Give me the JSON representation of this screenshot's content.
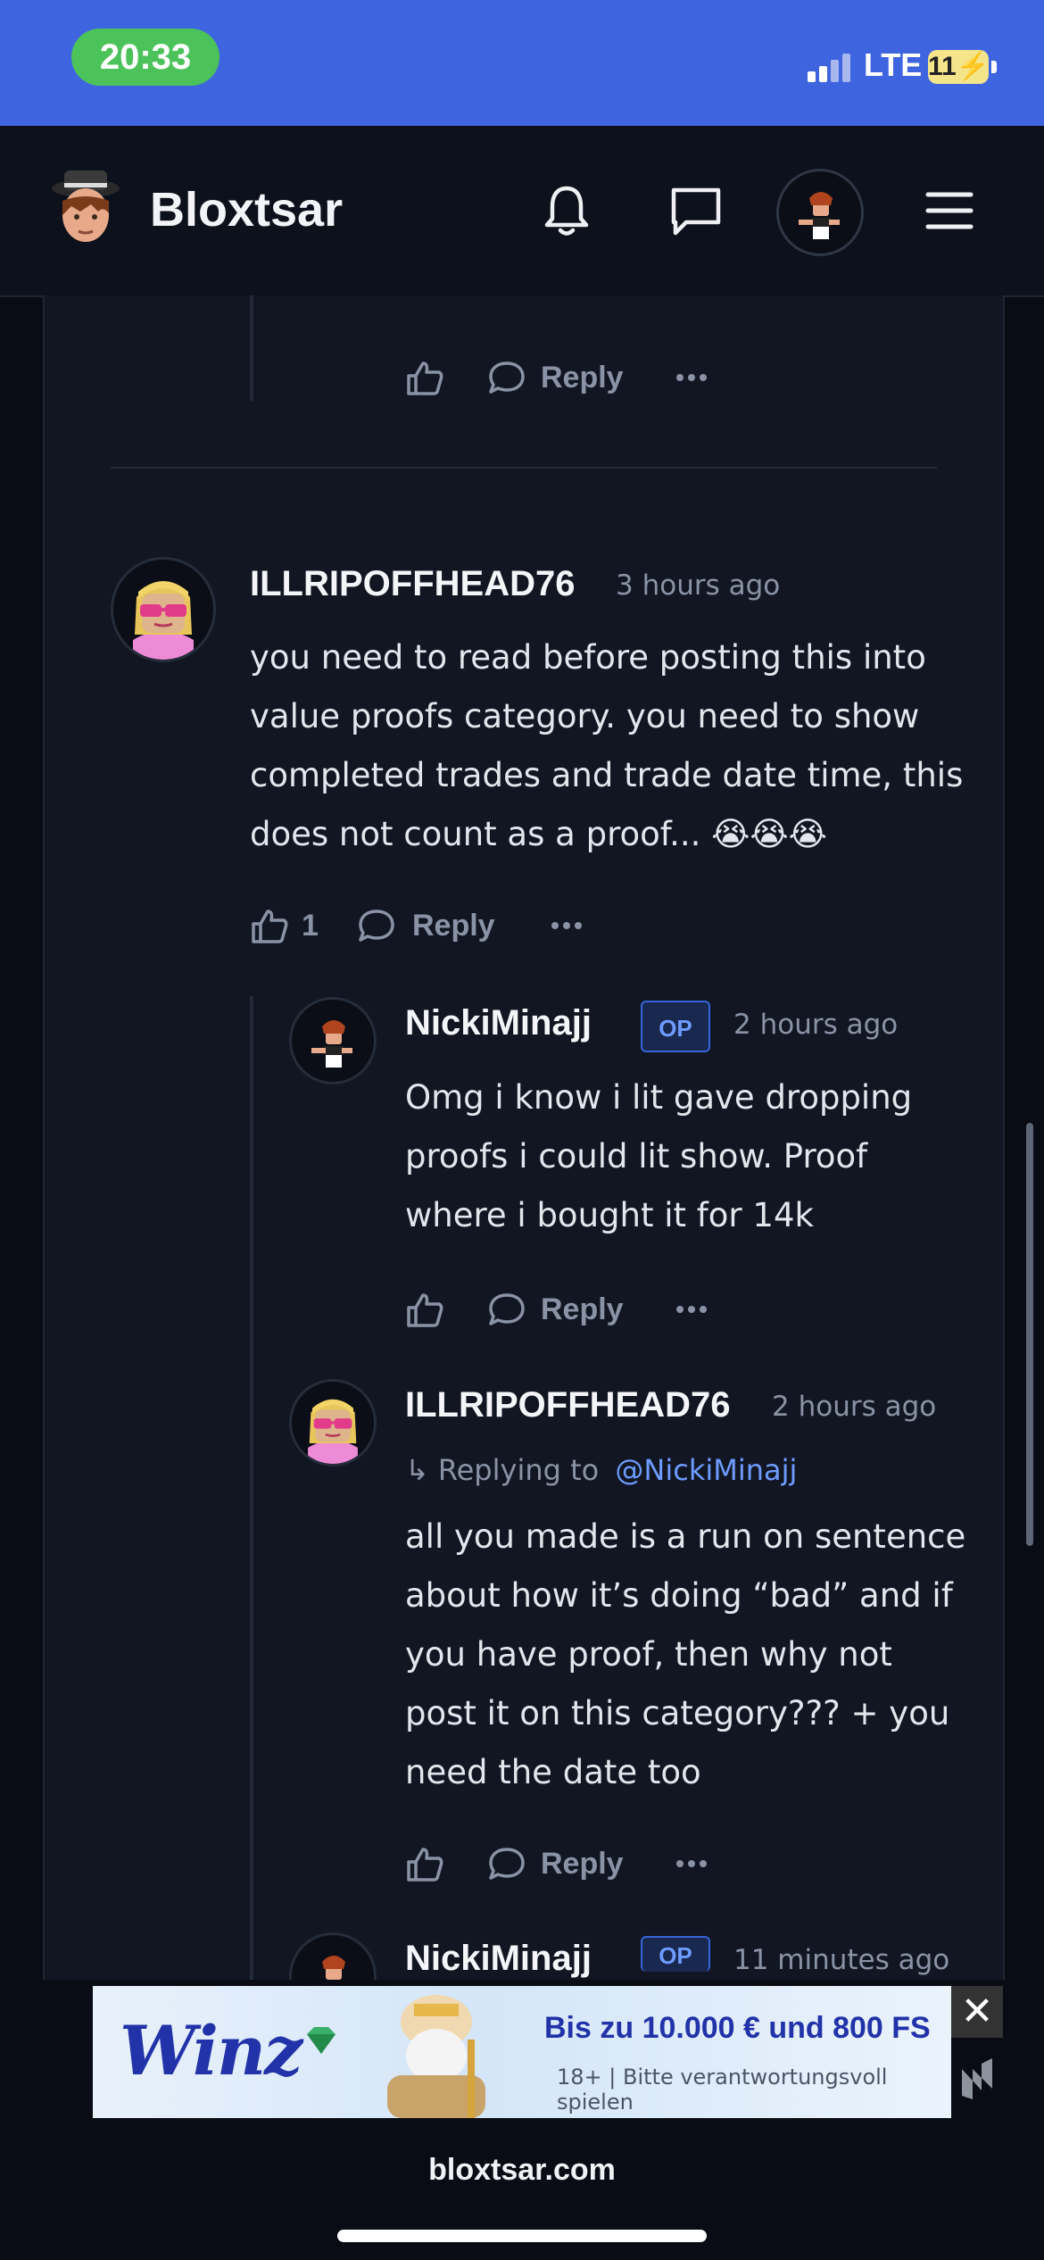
{
  "status_bar": {
    "time": "20:33",
    "network": "LTE",
    "battery": "11"
  },
  "header": {
    "brand": "Bloxtsar"
  },
  "thread": {
    "top_comment_actions": {
      "reply_label": "Reply"
    },
    "comment1": {
      "username": "ILLRIPOFFHEAD76",
      "time": "3 hours ago",
      "lines": [
        "you need to read before posting this into",
        "value proofs category. you need to show",
        "completed trades and trade date time, this",
        "does not count as a proof... 😭😭😭"
      ],
      "likes": "1",
      "reply_label": "Reply"
    },
    "reply1": {
      "username": "NickiMinajj",
      "badge": "OP",
      "time": "2 hours ago",
      "lines": [
        "Omg i know i lit gave dropping",
        "proofs i could lit show. Proof",
        "where i bought it for 14k"
      ],
      "reply_label": "Reply"
    },
    "reply2": {
      "username": "ILLRIPOFFHEAD76",
      "time": "2 hours ago",
      "replying_to_label": "Replying to",
      "replying_to_user": "@NickiMinajj",
      "lines": [
        "all you made is a run on sentence",
        "about how it’s doing “bad” and if",
        "you have proof, then why not",
        "post it on this category??? + you",
        "need the date too"
      ],
      "reply_label": "Reply"
    },
    "reply3": {
      "username": "NickiMinajj",
      "badge": "OP",
      "time": "11 minutes ago"
    }
  },
  "ad": {
    "logo": "Winz",
    "headline": "Bis zu 10.000 € und 800 FS",
    "subtext": "18+ | Bitte verantwortungsvoll spielen",
    "close": "✕"
  },
  "browser": {
    "url": "bloxtsar.com"
  }
}
